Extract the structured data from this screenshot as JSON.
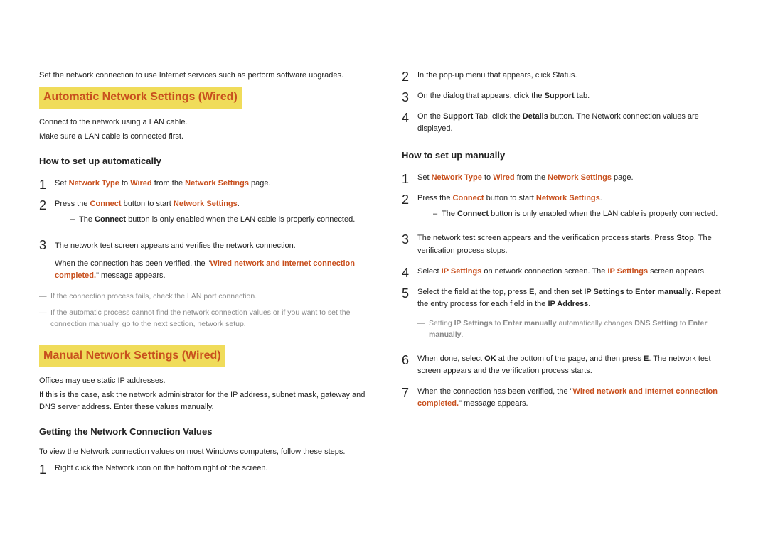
{
  "left": {
    "intro": "Set the network connection to use Internet services such as perform software upgrades.",
    "auto": {
      "title": "Automatic Network Settings (Wired)",
      "p1": "Connect to the network using a LAN cable.",
      "p2": "Make sure a LAN cable is connected first.",
      "subtitle": "How to set up automatically",
      "s1a": "Set ",
      "s1b": "Network Type",
      "s1c": " to ",
      "s1d": "Wired",
      "s1e": " from the ",
      "s1f": "Network Settings",
      "s1g": " page.",
      "s2a": "Press the ",
      "s2b": "Connect",
      "s2c": " button to start ",
      "s2d": "Network Settings",
      "s2e": ".",
      "s2sub_a": "The ",
      "s2sub_b": "Connect",
      "s2sub_c": " button is only enabled when the LAN cable is properly connected.",
      "s3a": "The network test screen appears and verifies the network connection.",
      "s3b": "When the connection has been verified, the \"",
      "s3c": "Wired network and Internet connection completed.",
      "s3d": "\" message appears.",
      "note1": "If the connection process fails, check the LAN port connection.",
      "note2": "If the automatic process cannot find the network connection values or if you want to set the connection manually, go to the next section, network setup."
    },
    "manual": {
      "title": "Manual Network Settings (Wired)",
      "p1": "Offices may use static IP addresses.",
      "p2": "If this is the case, ask the network administrator for the IP address, subnet mask, gateway and DNS server address. Enter these values manually.",
      "subtitle": "Getting the Network Connection Values",
      "desc": "To view the Network connection values on most Windows computers, follow these steps.",
      "s1": "Right click the Network icon on the bottom right of the screen."
    }
  },
  "right": {
    "s2": "In the pop-up menu that appears, click Status.",
    "s3a": "On the dialog that appears, click the ",
    "s3b": "Support",
    "s3c": " tab.",
    "s4a": "On the ",
    "s4b": "Support",
    "s4c": " Tab, click the ",
    "s4d": "Details",
    "s4e": " button. The Network connection values are displayed.",
    "manual": {
      "subtitle": "How to set up manually",
      "s1a": "Set ",
      "s1b": "Network Type",
      "s1c": " to ",
      "s1d": "Wired",
      "s1e": " from the ",
      "s1f": "Network Settings",
      "s1g": " page.",
      "s2a": "Press the ",
      "s2b": "Connect",
      "s2c": " button to start ",
      "s2d": "Network Settings",
      "s2e": ".",
      "s2sub_a": "The ",
      "s2sub_b": "Connect",
      "s2sub_c": " button is only enabled when the LAN cable is properly connected.",
      "s3a": "The network test screen appears and the verification process starts. Press ",
      "s3b": "Stop",
      "s3c": ". The verification process stops.",
      "s4a": "Select ",
      "s4b": "IP Settings",
      "s4c": " on network connection screen. The ",
      "s4d": "IP Settings",
      "s4e": " screen appears.",
      "s5a": "Select the field at the top, press ",
      "s5b": "E",
      "s5c": ", and then set ",
      "s5d": "IP Settings",
      "s5e": " to ",
      "s5f": "Enter manually",
      "s5g": ". Repeat the entry process for each field in the ",
      "s5h": "IP Address",
      "s5i": ".",
      "note_a": "Setting ",
      "note_b": "IP Settings",
      "note_c": " to ",
      "note_d": "Enter manually",
      "note_e": " automatically changes ",
      "note_f": "DNS Setting",
      "note_g": " to ",
      "note_h": "Enter manually",
      "note_i": ".",
      "s6a": "When done, select ",
      "s6b": "OK",
      "s6c": " at the bottom of the page, and then press ",
      "s6d": "E",
      "s6e": ". The network test screen appears and the verification process starts.",
      "s7a": "When the connection has been verified, the \"",
      "s7b": "Wired network and Internet connection completed.",
      "s7c": "\" message appears."
    }
  }
}
